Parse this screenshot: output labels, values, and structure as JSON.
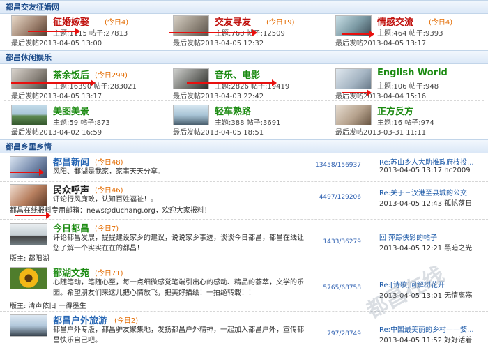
{
  "sections": [
    {
      "title": "都昌交友征婚网"
    },
    {
      "title": "都昌休闲娱乐"
    },
    {
      "title": "都昌乡里乡情"
    }
  ],
  "grid1": [
    {
      "name": "征婚嫁娶",
      "today": "(今日4)",
      "stats": "主题:1115  帖子:27813",
      "last": "最后发帖2013-04-05 13:00",
      "icon": "couple-photo"
    },
    {
      "name": "交友寻友",
      "today": "(今日19)",
      "stats": "主题:768  帖子:12509",
      "last": "最后发帖2013-04-05 12:32",
      "icon": "hands-photo"
    },
    {
      "name": "情感交流",
      "today": "(今日4)",
      "stats": "主题:464  帖子:9393",
      "last": "最后发帖2013-04-05 13:17",
      "icon": "lovers-photo"
    }
  ],
  "grid2": [
    {
      "name": "茶余饭后",
      "today": "(今日299)",
      "stats": "主题:16390  帖子:283021",
      "last": "最后发帖2013-04-05 13:17",
      "icon": "group-photo"
    },
    {
      "name": "音乐、电影",
      "today": "",
      "stats": "主题:2826  帖子:19419",
      "last": "最后发帖2013-04-03 22:42",
      "icon": "film-photo"
    },
    {
      "name": "English World",
      "today": "",
      "stats": "主题:106  帖子:948",
      "last": "最后发帖2013-04-04 15:16",
      "icon": "book-photo"
    },
    {
      "name": "美图美景",
      "today": "",
      "stats": "主题:59  帖子:873",
      "last": "最后发帖2013-04-02 16:59",
      "icon": "landscape-photo"
    },
    {
      "name": "轻车熟路",
      "today": "",
      "stats": "主题:388  帖子:3691",
      "last": "最后发帖2013-04-05 18:51",
      "icon": "cyclist-photo"
    },
    {
      "name": "正方反方",
      "today": "",
      "stats": "主题:16  帖子:974",
      "last": "最后发帖2013-03-31 11:11",
      "icon": "crowd-photo"
    }
  ],
  "forums": [
    {
      "name": "都昌新闻",
      "today": "(今日48)",
      "desc": "风阳、鄱湖是我家，家事天天分享。",
      "mods": "",
      "counts": "13458/156937",
      "last_title": "Re:苏山乡人大助推政府枝投...",
      "last_meta": "2013-04-05 13:17 hc2009",
      "icon": "news-photo"
    },
    {
      "name": "民众呼声",
      "today": "(今日46)",
      "desc": "评论行风廉政，认知百姓福祉！。",
      "mods": "都昌在线报料专用邮箱：news@duchang.org，欢迎大家报料！",
      "counts": "4497/129206",
      "last_title": "Re:关于三汊港至县城的公交",
      "last_meta": "2013-04-05 12:43 孤帆落日",
      "icon": "crowd-photo"
    },
    {
      "name": "今日都昌",
      "today": "(今日7)",
      "desc": "评论都昌发展，提提建设家乡的建议，说说家乡事迹，谈谈今日都昌，都昌在线让您了解一个实实在在的都昌！",
      "mods": "版主: 都阳湖",
      "counts": "1433/36279",
      "last_title": "回 萍踪侠影的帖子",
      "last_meta": "2013-04-05 12:21 黑暗之光",
      "icon": "pavilion-photo"
    },
    {
      "name": "鄱湖文苑",
      "today": "(今日71)",
      "desc": "心随笔动，笔随心至，每一点细微感觉笔端引出心的感动、精品的荟萃，文学的乐园。希望朋友们来这儿把心情放飞，把美好描绘！一拍绝转载！！",
      "mods": "版主: 清声依旧 一得墨生",
      "counts": "5765/68758",
      "last_title": "Re:[诗歌]问解树花开",
      "last_meta": "2013-04-05 13:01 无情离殇",
      "icon": "sunflower-photo"
    },
    {
      "name": "都昌户外旅游",
      "today": "(今日2)",
      "desc": "都昌户外专版，都昌驴友聚集地，发扬都昌户外精神，一起加入都昌户外，宣传都昌快乐自己吧。",
      "mods": "",
      "counts": "797/28749",
      "last_title": "Re:中国最美丽的乡村——婺...",
      "last_meta": "2013-04-05 11:52 好好活着",
      "icon": "hikers-photo"
    }
  ],
  "watermark": "都昌在线",
  "colors": {
    "section_text": "#1f4e8c",
    "red_name": "#c0100c",
    "green_name": "#1c8b12",
    "forum_name": "#2767b5",
    "today": "#e36b00",
    "arrow": "#e8100e"
  }
}
